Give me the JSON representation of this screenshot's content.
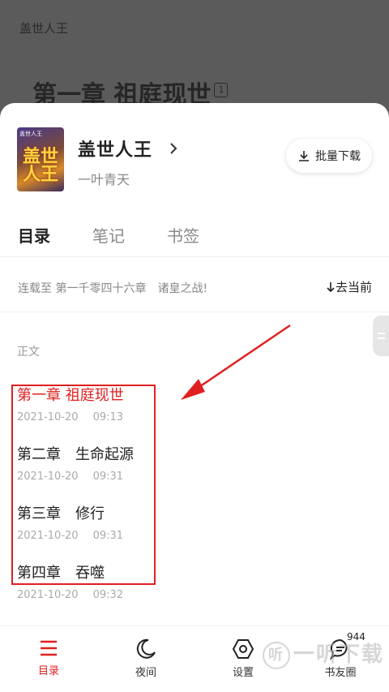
{
  "reader": {
    "book_name": "盖世人王",
    "chapter_title": "第一章 祖庭现世",
    "chapter_badge": "1"
  },
  "book": {
    "title": "盖世人王",
    "author": "一叶青天",
    "cover_text": "盖世人王",
    "cover_top_text": "盖世人王",
    "batch_download_label": "批量下载"
  },
  "tabs": [
    "目录",
    "笔记",
    "书签"
  ],
  "serial": {
    "text": "连载至 第一千零四十六章　诸皇之战!",
    "goto_current_label": "去当前"
  },
  "section_label": "正文",
  "chapters": [
    {
      "title": "第一章 祖庭现世",
      "date": "2021-10-20",
      "time": "09:13",
      "current": true
    },
    {
      "title": "第二章　生命起源",
      "date": "2021-10-20",
      "time": "09:31",
      "current": false
    },
    {
      "title": "第三章　修行",
      "date": "2021-10-20",
      "time": "09:31",
      "current": false
    },
    {
      "title": "第四章　吞噬",
      "date": "2021-10-20",
      "time": "09:32",
      "current": false
    }
  ],
  "bottom_nav": [
    {
      "label": "目录",
      "icon": "menu-icon",
      "active": true
    },
    {
      "label": "夜间",
      "icon": "moon-icon",
      "active": false
    },
    {
      "label": "设置",
      "icon": "settings-icon",
      "active": false
    },
    {
      "label": "书友圈",
      "icon": "chat-icon",
      "active": false,
      "badge": "944"
    }
  ],
  "watermark": {
    "icon_text": "听",
    "text": "一听下载"
  },
  "colors": {
    "accent": "#e02020",
    "overlay": "#5b5b5b"
  }
}
